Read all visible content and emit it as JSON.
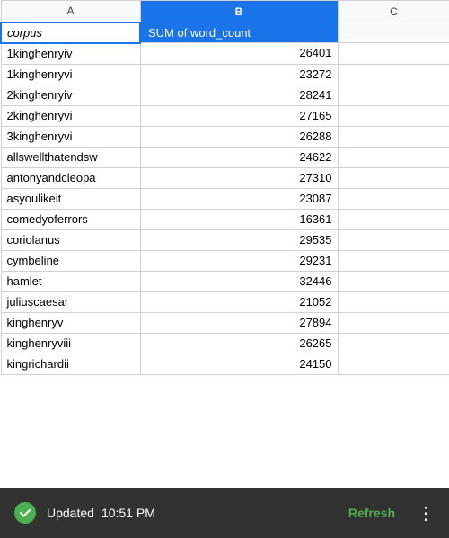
{
  "columns": {
    "a_label": "A",
    "b_label": "B",
    "c_label": "C"
  },
  "header": {
    "col_a": "corpus",
    "col_b": "SUM of word_count"
  },
  "rows": [
    {
      "corpus": "1kinghenryiv",
      "word_count": "26401"
    },
    {
      "corpus": "1kinghenryvi",
      "word_count": "23272"
    },
    {
      "corpus": "2kinghenryiv",
      "word_count": "28241"
    },
    {
      "corpus": "2kinghenryvi",
      "word_count": "27165"
    },
    {
      "corpus": "3kinghenryvi",
      "word_count": "26288"
    },
    {
      "corpus": "allswellthatendsw",
      "word_count": "24622"
    },
    {
      "corpus": "antonyandcleopa",
      "word_count": "27310"
    },
    {
      "corpus": "asyoulikeit",
      "word_count": "23087"
    },
    {
      "corpus": "comedyoferrors",
      "word_count": "16361"
    },
    {
      "corpus": "coriolanus",
      "word_count": "29535"
    },
    {
      "corpus": "cymbeline",
      "word_count": "29231"
    },
    {
      "corpus": "hamlet",
      "word_count": "32446"
    },
    {
      "corpus": "juliuscaesar",
      "word_count": "21052"
    },
    {
      "corpus": "kinghenryv",
      "word_count": "27894"
    },
    {
      "corpus": "kinghenryviii",
      "word_count": "26265"
    },
    {
      "corpus": "kingrichardii",
      "word_count": "24150"
    }
  ],
  "toast": {
    "updated_label": "Updated",
    "time": "10:51 PM",
    "refresh_label": "Refresh",
    "dots": "⋮"
  }
}
